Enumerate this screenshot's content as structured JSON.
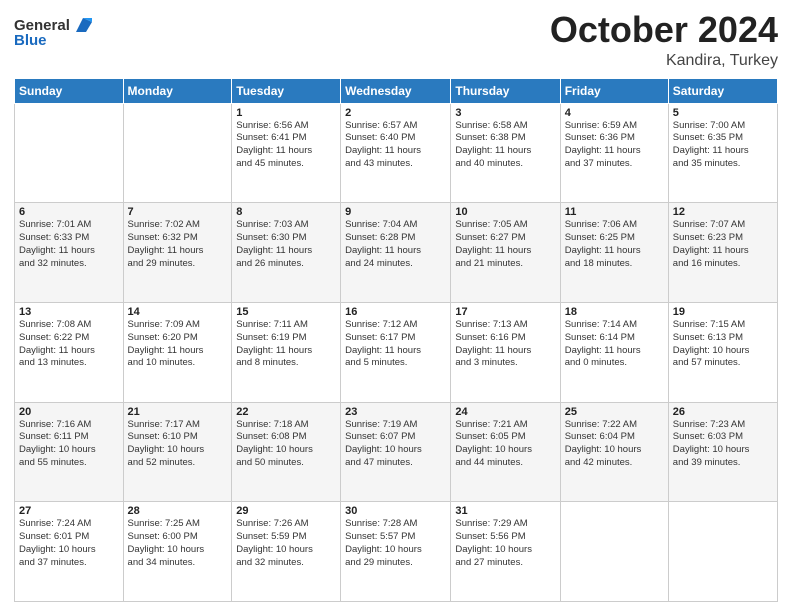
{
  "header": {
    "logo_general": "General",
    "logo_blue": "Blue",
    "title": "October 2024",
    "location": "Kandira, Turkey"
  },
  "weekdays": [
    "Sunday",
    "Monday",
    "Tuesday",
    "Wednesday",
    "Thursday",
    "Friday",
    "Saturday"
  ],
  "weeks": [
    [
      {
        "day": "",
        "sunrise": "",
        "sunset": "",
        "daylight": ""
      },
      {
        "day": "",
        "sunrise": "",
        "sunset": "",
        "daylight": ""
      },
      {
        "day": "1",
        "sunrise": "Sunrise: 6:56 AM",
        "sunset": "Sunset: 6:41 PM",
        "daylight": "Daylight: 11 hours and 45 minutes."
      },
      {
        "day": "2",
        "sunrise": "Sunrise: 6:57 AM",
        "sunset": "Sunset: 6:40 PM",
        "daylight": "Daylight: 11 hours and 43 minutes."
      },
      {
        "day": "3",
        "sunrise": "Sunrise: 6:58 AM",
        "sunset": "Sunset: 6:38 PM",
        "daylight": "Daylight: 11 hours and 40 minutes."
      },
      {
        "day": "4",
        "sunrise": "Sunrise: 6:59 AM",
        "sunset": "Sunset: 6:36 PM",
        "daylight": "Daylight: 11 hours and 37 minutes."
      },
      {
        "day": "5",
        "sunrise": "Sunrise: 7:00 AM",
        "sunset": "Sunset: 6:35 PM",
        "daylight": "Daylight: 11 hours and 35 minutes."
      }
    ],
    [
      {
        "day": "6",
        "sunrise": "Sunrise: 7:01 AM",
        "sunset": "Sunset: 6:33 PM",
        "daylight": "Daylight: 11 hours and 32 minutes."
      },
      {
        "day": "7",
        "sunrise": "Sunrise: 7:02 AM",
        "sunset": "Sunset: 6:32 PM",
        "daylight": "Daylight: 11 hours and 29 minutes."
      },
      {
        "day": "8",
        "sunrise": "Sunrise: 7:03 AM",
        "sunset": "Sunset: 6:30 PM",
        "daylight": "Daylight: 11 hours and 26 minutes."
      },
      {
        "day": "9",
        "sunrise": "Sunrise: 7:04 AM",
        "sunset": "Sunset: 6:28 PM",
        "daylight": "Daylight: 11 hours and 24 minutes."
      },
      {
        "day": "10",
        "sunrise": "Sunrise: 7:05 AM",
        "sunset": "Sunset: 6:27 PM",
        "daylight": "Daylight: 11 hours and 21 minutes."
      },
      {
        "day": "11",
        "sunrise": "Sunrise: 7:06 AM",
        "sunset": "Sunset: 6:25 PM",
        "daylight": "Daylight: 11 hours and 18 minutes."
      },
      {
        "day": "12",
        "sunrise": "Sunrise: 7:07 AM",
        "sunset": "Sunset: 6:23 PM",
        "daylight": "Daylight: 11 hours and 16 minutes."
      }
    ],
    [
      {
        "day": "13",
        "sunrise": "Sunrise: 7:08 AM",
        "sunset": "Sunset: 6:22 PM",
        "daylight": "Daylight: 11 hours and 13 minutes."
      },
      {
        "day": "14",
        "sunrise": "Sunrise: 7:09 AM",
        "sunset": "Sunset: 6:20 PM",
        "daylight": "Daylight: 11 hours and 10 minutes."
      },
      {
        "day": "15",
        "sunrise": "Sunrise: 7:11 AM",
        "sunset": "Sunset: 6:19 PM",
        "daylight": "Daylight: 11 hours and 8 minutes."
      },
      {
        "day": "16",
        "sunrise": "Sunrise: 7:12 AM",
        "sunset": "Sunset: 6:17 PM",
        "daylight": "Daylight: 11 hours and 5 minutes."
      },
      {
        "day": "17",
        "sunrise": "Sunrise: 7:13 AM",
        "sunset": "Sunset: 6:16 PM",
        "daylight": "Daylight: 11 hours and 3 minutes."
      },
      {
        "day": "18",
        "sunrise": "Sunrise: 7:14 AM",
        "sunset": "Sunset: 6:14 PM",
        "daylight": "Daylight: 11 hours and 0 minutes."
      },
      {
        "day": "19",
        "sunrise": "Sunrise: 7:15 AM",
        "sunset": "Sunset: 6:13 PM",
        "daylight": "Daylight: 10 hours and 57 minutes."
      }
    ],
    [
      {
        "day": "20",
        "sunrise": "Sunrise: 7:16 AM",
        "sunset": "Sunset: 6:11 PM",
        "daylight": "Daylight: 10 hours and 55 minutes."
      },
      {
        "day": "21",
        "sunrise": "Sunrise: 7:17 AM",
        "sunset": "Sunset: 6:10 PM",
        "daylight": "Daylight: 10 hours and 52 minutes."
      },
      {
        "day": "22",
        "sunrise": "Sunrise: 7:18 AM",
        "sunset": "Sunset: 6:08 PM",
        "daylight": "Daylight: 10 hours and 50 minutes."
      },
      {
        "day": "23",
        "sunrise": "Sunrise: 7:19 AM",
        "sunset": "Sunset: 6:07 PM",
        "daylight": "Daylight: 10 hours and 47 minutes."
      },
      {
        "day": "24",
        "sunrise": "Sunrise: 7:21 AM",
        "sunset": "Sunset: 6:05 PM",
        "daylight": "Daylight: 10 hours and 44 minutes."
      },
      {
        "day": "25",
        "sunrise": "Sunrise: 7:22 AM",
        "sunset": "Sunset: 6:04 PM",
        "daylight": "Daylight: 10 hours and 42 minutes."
      },
      {
        "day": "26",
        "sunrise": "Sunrise: 7:23 AM",
        "sunset": "Sunset: 6:03 PM",
        "daylight": "Daylight: 10 hours and 39 minutes."
      }
    ],
    [
      {
        "day": "27",
        "sunrise": "Sunrise: 7:24 AM",
        "sunset": "Sunset: 6:01 PM",
        "daylight": "Daylight: 10 hours and 37 minutes."
      },
      {
        "day": "28",
        "sunrise": "Sunrise: 7:25 AM",
        "sunset": "Sunset: 6:00 PM",
        "daylight": "Daylight: 10 hours and 34 minutes."
      },
      {
        "day": "29",
        "sunrise": "Sunrise: 7:26 AM",
        "sunset": "Sunset: 5:59 PM",
        "daylight": "Daylight: 10 hours and 32 minutes."
      },
      {
        "day": "30",
        "sunrise": "Sunrise: 7:28 AM",
        "sunset": "Sunset: 5:57 PM",
        "daylight": "Daylight: 10 hours and 29 minutes."
      },
      {
        "day": "31",
        "sunrise": "Sunrise: 7:29 AM",
        "sunset": "Sunset: 5:56 PM",
        "daylight": "Daylight: 10 hours and 27 minutes."
      },
      {
        "day": "",
        "sunrise": "",
        "sunset": "",
        "daylight": ""
      },
      {
        "day": "",
        "sunrise": "",
        "sunset": "",
        "daylight": ""
      }
    ]
  ]
}
